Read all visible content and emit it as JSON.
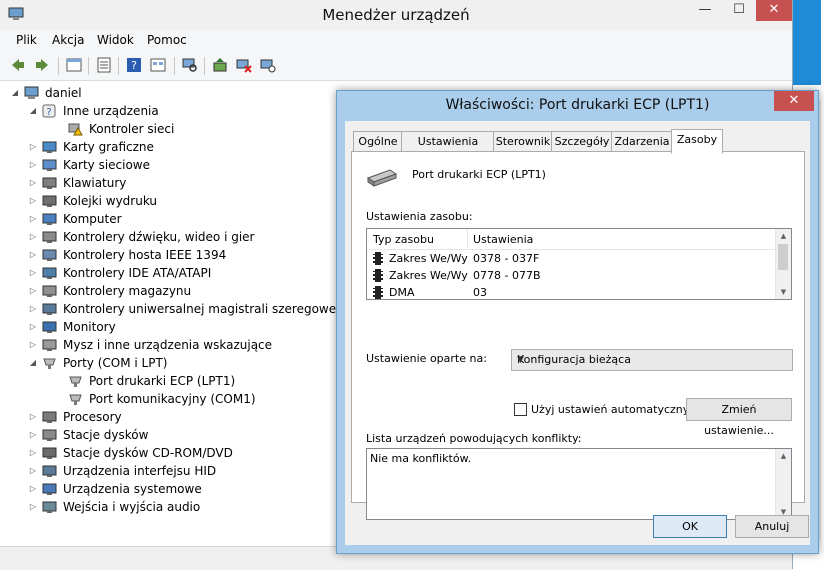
{
  "window": {
    "title": "Menedżer urządzeń"
  },
  "menu": [
    "Plik",
    "Akcja",
    "Widok",
    "Pomoc"
  ],
  "tree": {
    "root": "daniel",
    "items": [
      {
        "label": "Inne urządzenia",
        "expanded": true,
        "children": [
          "Kontroler sieci"
        ]
      },
      {
        "label": "Karty graficzne"
      },
      {
        "label": "Karty sieciowe"
      },
      {
        "label": "Klawiatury"
      },
      {
        "label": "Kolejki wydruku"
      },
      {
        "label": "Komputer"
      },
      {
        "label": "Kontrolery dźwięku, wideo i gier"
      },
      {
        "label": "Kontrolery hosta IEEE 1394"
      },
      {
        "label": "Kontrolery IDE ATA/ATAPI"
      },
      {
        "label": "Kontrolery magazynu"
      },
      {
        "label": "Kontrolery uniwersalnej magistrali szeregowej"
      },
      {
        "label": "Monitory"
      },
      {
        "label": "Mysz i inne urządzenia wskazujące"
      },
      {
        "label": "Porty (COM i LPT)",
        "expanded": true,
        "children": [
          "Port drukarki ECP (LPT1)",
          "Port komunikacyjny (COM1)"
        ]
      },
      {
        "label": "Procesory"
      },
      {
        "label": "Stacje dysków"
      },
      {
        "label": "Stacje dysków CD-ROM/DVD"
      },
      {
        "label": "Urządzenia interfejsu HID"
      },
      {
        "label": "Urządzenia systemowe"
      },
      {
        "label": "Wejścia i wyjścia audio"
      }
    ]
  },
  "dialog": {
    "title": "Właściwości: Port drukarki ECP (LPT1)",
    "tabs": [
      "Ogólne",
      "Ustawienia portu",
      "Sterownik",
      "Szczegóły",
      "Zdarzenia",
      "Zasoby"
    ],
    "active_tab": "Zasoby",
    "device_name": "Port drukarki ECP (LPT1)",
    "resource_settings_label": "Ustawienia zasobu:",
    "columns": [
      "Typ zasobu",
      "Ustawienia"
    ],
    "resources": [
      {
        "type": "Zakres We/Wy",
        "setting": "0378 - 037F"
      },
      {
        "type": "Zakres We/Wy",
        "setting": "0778 - 077B"
      },
      {
        "type": "DMA",
        "setting": "03"
      }
    ],
    "setting_based_on_label": "Ustawienie oparte na:",
    "setting_based_on_value": "Konfiguracja bieżąca",
    "auto_settings_label": "Użyj ustawień automatycznych",
    "auto_settings_checked": false,
    "change_settings_button": "Zmień ustawienie...",
    "conflict_list_label": "Lista urządzeń powodujących konflikty:",
    "conflict_text": "Nie ma konfliktów.",
    "ok_button": "OK",
    "cancel_button": "Anuluj"
  },
  "colors": {
    "accent": "#1f8ad6",
    "close": "#c75050",
    "dialog_frame": "#a9cdea"
  }
}
